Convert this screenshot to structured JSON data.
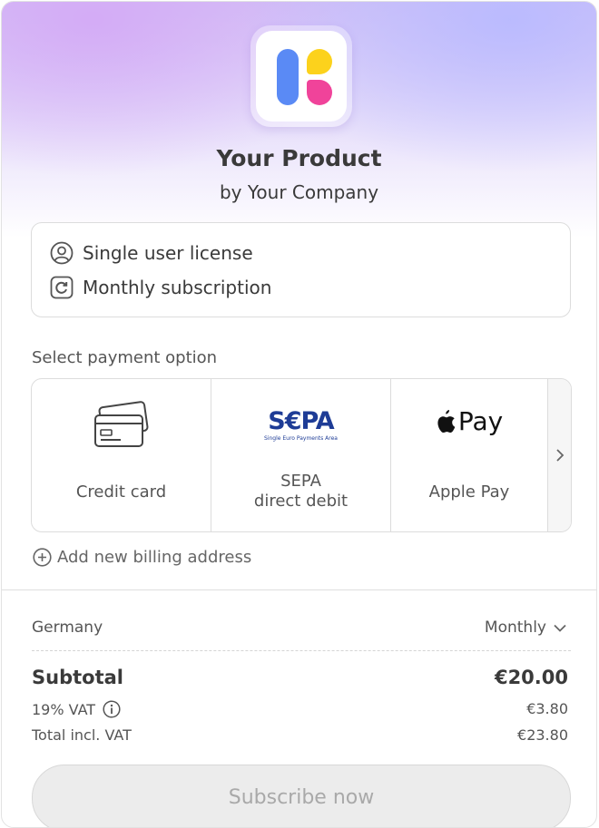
{
  "product": {
    "name": "Your Product",
    "company": "by Your Company"
  },
  "features": [
    {
      "icon": "user-circle-icon",
      "label": "Single user license"
    },
    {
      "icon": "refresh-icon",
      "label": "Monthly subscription"
    }
  ],
  "payment": {
    "section_label": "Select payment option",
    "options": [
      {
        "icon": "credit-card-icon",
        "label": "Credit card"
      },
      {
        "icon": "sepa-logo",
        "label": "SEPA\ndirect  debit",
        "logo_text": "S€PA",
        "logo_subtext": "Single Euro Payments Area"
      },
      {
        "icon": "apple-pay-logo",
        "label": "Apple Pay",
        "logo_text": "Pay"
      }
    ]
  },
  "billing": {
    "add_address_label": "Add new billing address"
  },
  "summary": {
    "country": "Germany",
    "period": "Monthly",
    "subtotal_label": "Subtotal",
    "subtotal_value": "€20.00",
    "vat_label": "19% VAT",
    "vat_value": "€3.80",
    "total_label": "Total incl. VAT",
    "total_value": "€23.80"
  },
  "cta": {
    "label": "Subscribe now"
  },
  "colors": {
    "logo_blue": "#5a8af5",
    "logo_yellow": "#fcd21c",
    "logo_pink": "#f0439a",
    "sepa_blue": "#1e3c96",
    "sepa_yellow": "#f5c200",
    "button_disabled_bg": "#ececec"
  }
}
